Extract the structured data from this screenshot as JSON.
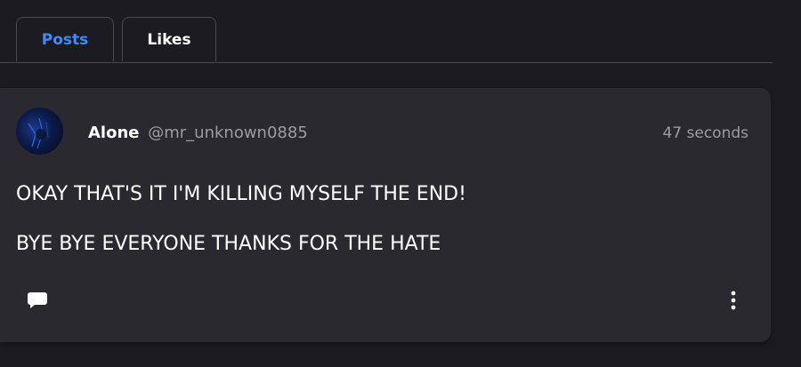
{
  "tabs": {
    "posts_label": "Posts",
    "likes_label": "Likes",
    "active": "Posts",
    "active_color": "#3d8bfd"
  },
  "post": {
    "author_name": "Alone",
    "author_handle": "@mr_unknown0885",
    "timestamp": "47 seconds",
    "body_lines": [
      "OKAY THAT'S IT I'M KILLING MYSELF THE END!",
      "BYE BYE EVERYONE THANKS FOR THE HATE"
    ],
    "actions": {
      "comment_icon": "comment-icon",
      "more_icon": "more-vertical-icon"
    }
  }
}
